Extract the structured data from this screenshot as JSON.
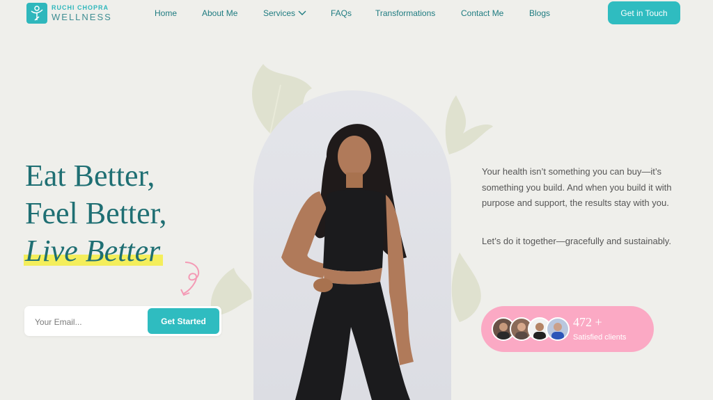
{
  "brand": {
    "top": "RUCHI CHOPRA",
    "bottom": "WELLNESS"
  },
  "nav": {
    "items": [
      "Home",
      "About Me",
      "Services",
      "FAQs",
      "Transformations",
      "Contact Me",
      "Blogs"
    ],
    "cta": "Get in Touch"
  },
  "hero": {
    "line1": "Eat Better,",
    "line2": "Feel Better,",
    "line3": "Live Better",
    "email_placeholder": "Your Email...",
    "submit": "Get Started"
  },
  "right": {
    "para1": "Your health isn’t something you can buy—it’s something you build. And when you build it with purpose and support, the results stay with you.",
    "para2": "Let’s do it together—gracefully and sustainably."
  },
  "clients": {
    "count": "472 +",
    "label": "Satisfied clients"
  },
  "colors": {
    "teal": "#2fbcc0",
    "dark_teal": "#1f6f73",
    "pink": "#fba9c4",
    "highlight": "#f4ee5b",
    "background": "#efefeb"
  }
}
